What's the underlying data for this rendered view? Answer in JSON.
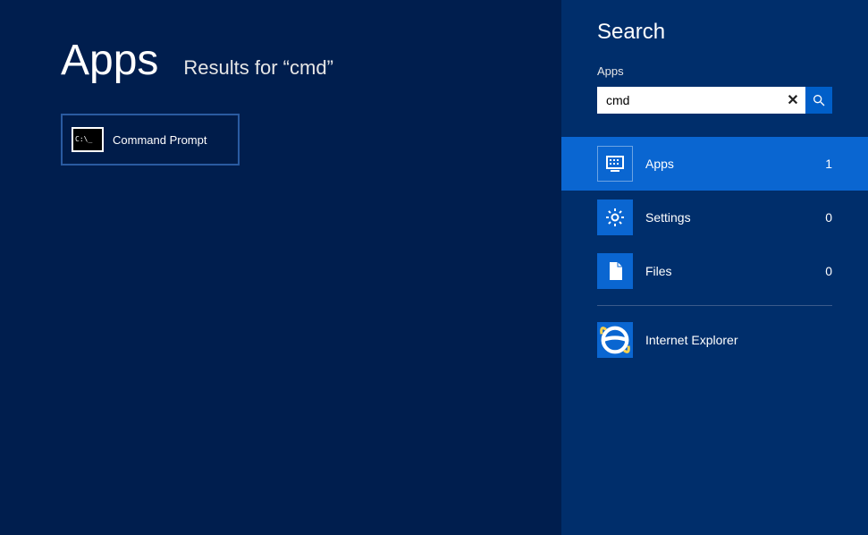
{
  "main": {
    "title": "Apps",
    "subtitle_prefix": "Results for “",
    "query_echo": "cmd",
    "subtitle_suffix": "”",
    "results": [
      {
        "label": "Command Prompt",
        "icon_text": "C:\\_"
      }
    ]
  },
  "search": {
    "title": "Search",
    "context": "Apps",
    "query": "cmd",
    "clear_glyph": "✕",
    "categories": [
      {
        "key": "apps",
        "label": "Apps",
        "count": "1",
        "selected": true
      },
      {
        "key": "settings",
        "label": "Settings",
        "count": "0",
        "selected": false
      },
      {
        "key": "files",
        "label": "Files",
        "count": "0",
        "selected": false
      }
    ],
    "apps": [
      {
        "key": "ie",
        "label": "Internet Explorer"
      }
    ]
  }
}
